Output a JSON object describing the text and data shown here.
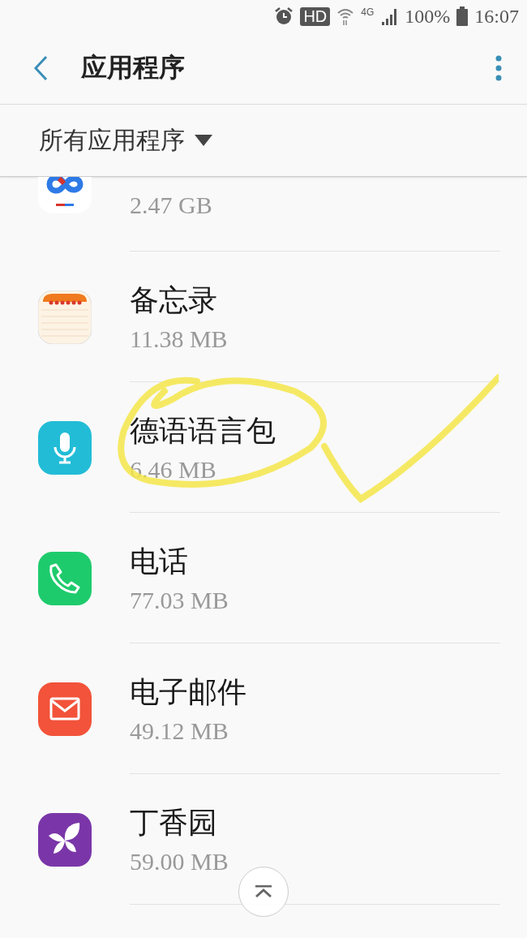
{
  "status_bar": {
    "hd": "HD",
    "network": "4G",
    "battery": "100%",
    "time": "16:07"
  },
  "header": {
    "title": "应用程序"
  },
  "filter": {
    "label": "所有应用程序"
  },
  "apps": [
    {
      "kind": "cloud",
      "size": "2.47 GB"
    },
    {
      "kind": "memo",
      "name": "备忘录",
      "size": "11.38 MB"
    },
    {
      "kind": "voice",
      "name": "德语语言包",
      "size": "6.46 MB"
    },
    {
      "kind": "phone",
      "name": "电话",
      "size": "77.03 MB"
    },
    {
      "kind": "email",
      "name": "电子邮件",
      "size": "49.12 MB"
    },
    {
      "kind": "clove",
      "name": "丁香园",
      "size": "59.00 MB"
    }
  ]
}
